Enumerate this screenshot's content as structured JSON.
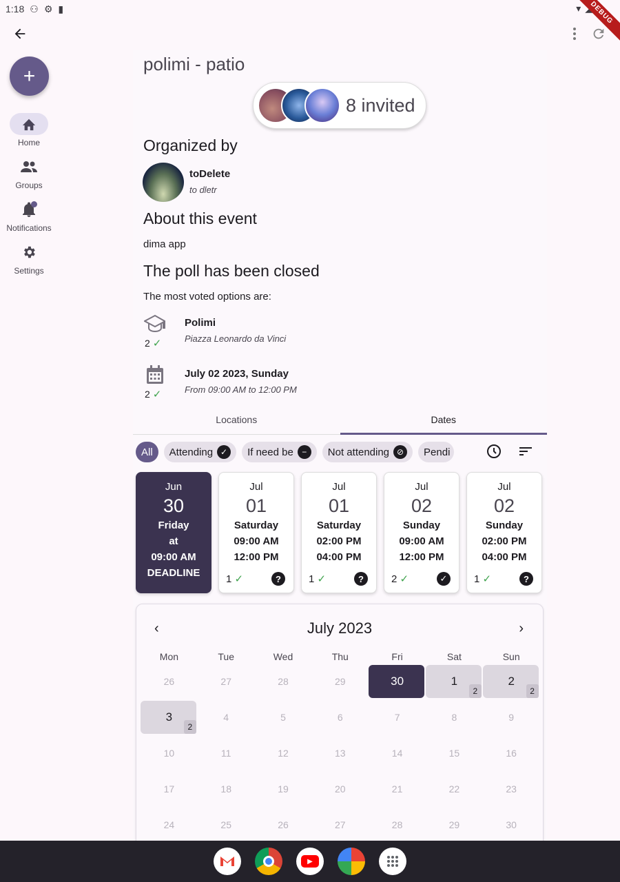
{
  "status_bar": {
    "time": "1:18",
    "debug_label": "DEBUG"
  },
  "nav_rail": {
    "fab_label": "+",
    "items": [
      {
        "label": "Home",
        "icon": "home-icon"
      },
      {
        "label": "Groups",
        "icon": "groups-icon"
      },
      {
        "label": "Notifications",
        "icon": "bell-icon"
      },
      {
        "label": "Settings",
        "icon": "gear-icon"
      }
    ]
  },
  "event": {
    "title": "polimi - patio",
    "invited_label": "8 invited",
    "organized_by_heading": "Organized by",
    "organizer": {
      "name": "toDelete",
      "subtitle": "to dletr"
    },
    "about_heading": "About this event",
    "about_text": "dima app",
    "poll_heading": "The poll has been closed",
    "most_voted_label": "The most voted options are:",
    "options": [
      {
        "icon": "school-icon",
        "count": "2",
        "title": "Polimi",
        "subtitle": "Piazza Leonardo da Vinci"
      },
      {
        "icon": "calendar-icon",
        "count": "2",
        "title": "July 02 2023, Sunday",
        "subtitle": "From 09:00 AM to 12:00 PM"
      }
    ]
  },
  "tabs": [
    {
      "label": "Locations"
    },
    {
      "label": "Dates"
    }
  ],
  "filters": [
    {
      "label": "All"
    },
    {
      "label": "Attending"
    },
    {
      "label": "If need be"
    },
    {
      "label": "Not attending"
    },
    {
      "label": "Pendi"
    }
  ],
  "date_cards": [
    {
      "month": "Jun",
      "day": "30",
      "weekday": "Friday",
      "line1": "at",
      "line2": "09:00 AM",
      "line3": "DEADLINE"
    },
    {
      "month": "Jul",
      "day": "01",
      "weekday": "Saturday",
      "line1": "09:00 AM",
      "line2": "12:00 PM",
      "count": "1",
      "status": "?"
    },
    {
      "month": "Jul",
      "day": "01",
      "weekday": "Saturday",
      "line1": "02:00 PM",
      "line2": "04:00 PM",
      "count": "1",
      "status": "?"
    },
    {
      "month": "Jul",
      "day": "02",
      "weekday": "Sunday",
      "line1": "09:00 AM",
      "line2": "12:00 PM",
      "count": "2",
      "status": "✓"
    },
    {
      "month": "Jul",
      "day": "02",
      "weekday": "Sunday",
      "line1": "02:00 PM",
      "line2": "04:00 PM",
      "count": "1",
      "status": "?"
    }
  ],
  "calendar": {
    "month_label": "July 2023",
    "weekdays": [
      "Mon",
      "Tue",
      "Wed",
      "Thu",
      "Fri",
      "Sat",
      "Sun"
    ],
    "rows": [
      [
        "26",
        "27",
        "28",
        "29",
        "30",
        "1",
        "2"
      ],
      [
        "3",
        "4",
        "5",
        "6",
        "7",
        "8",
        "9"
      ],
      [
        "10",
        "11",
        "12",
        "13",
        "14",
        "15",
        "16"
      ],
      [
        "17",
        "18",
        "19",
        "20",
        "21",
        "22",
        "23"
      ],
      [
        "24",
        "25",
        "26",
        "27",
        "28",
        "29",
        "30"
      ]
    ],
    "vote_counts": {
      "1": "2",
      "2": "2",
      "3": "2"
    }
  },
  "taskbar": [
    "gmail-icon",
    "chrome-icon",
    "youtube-icon",
    "photos-icon",
    "apps-icon"
  ]
}
